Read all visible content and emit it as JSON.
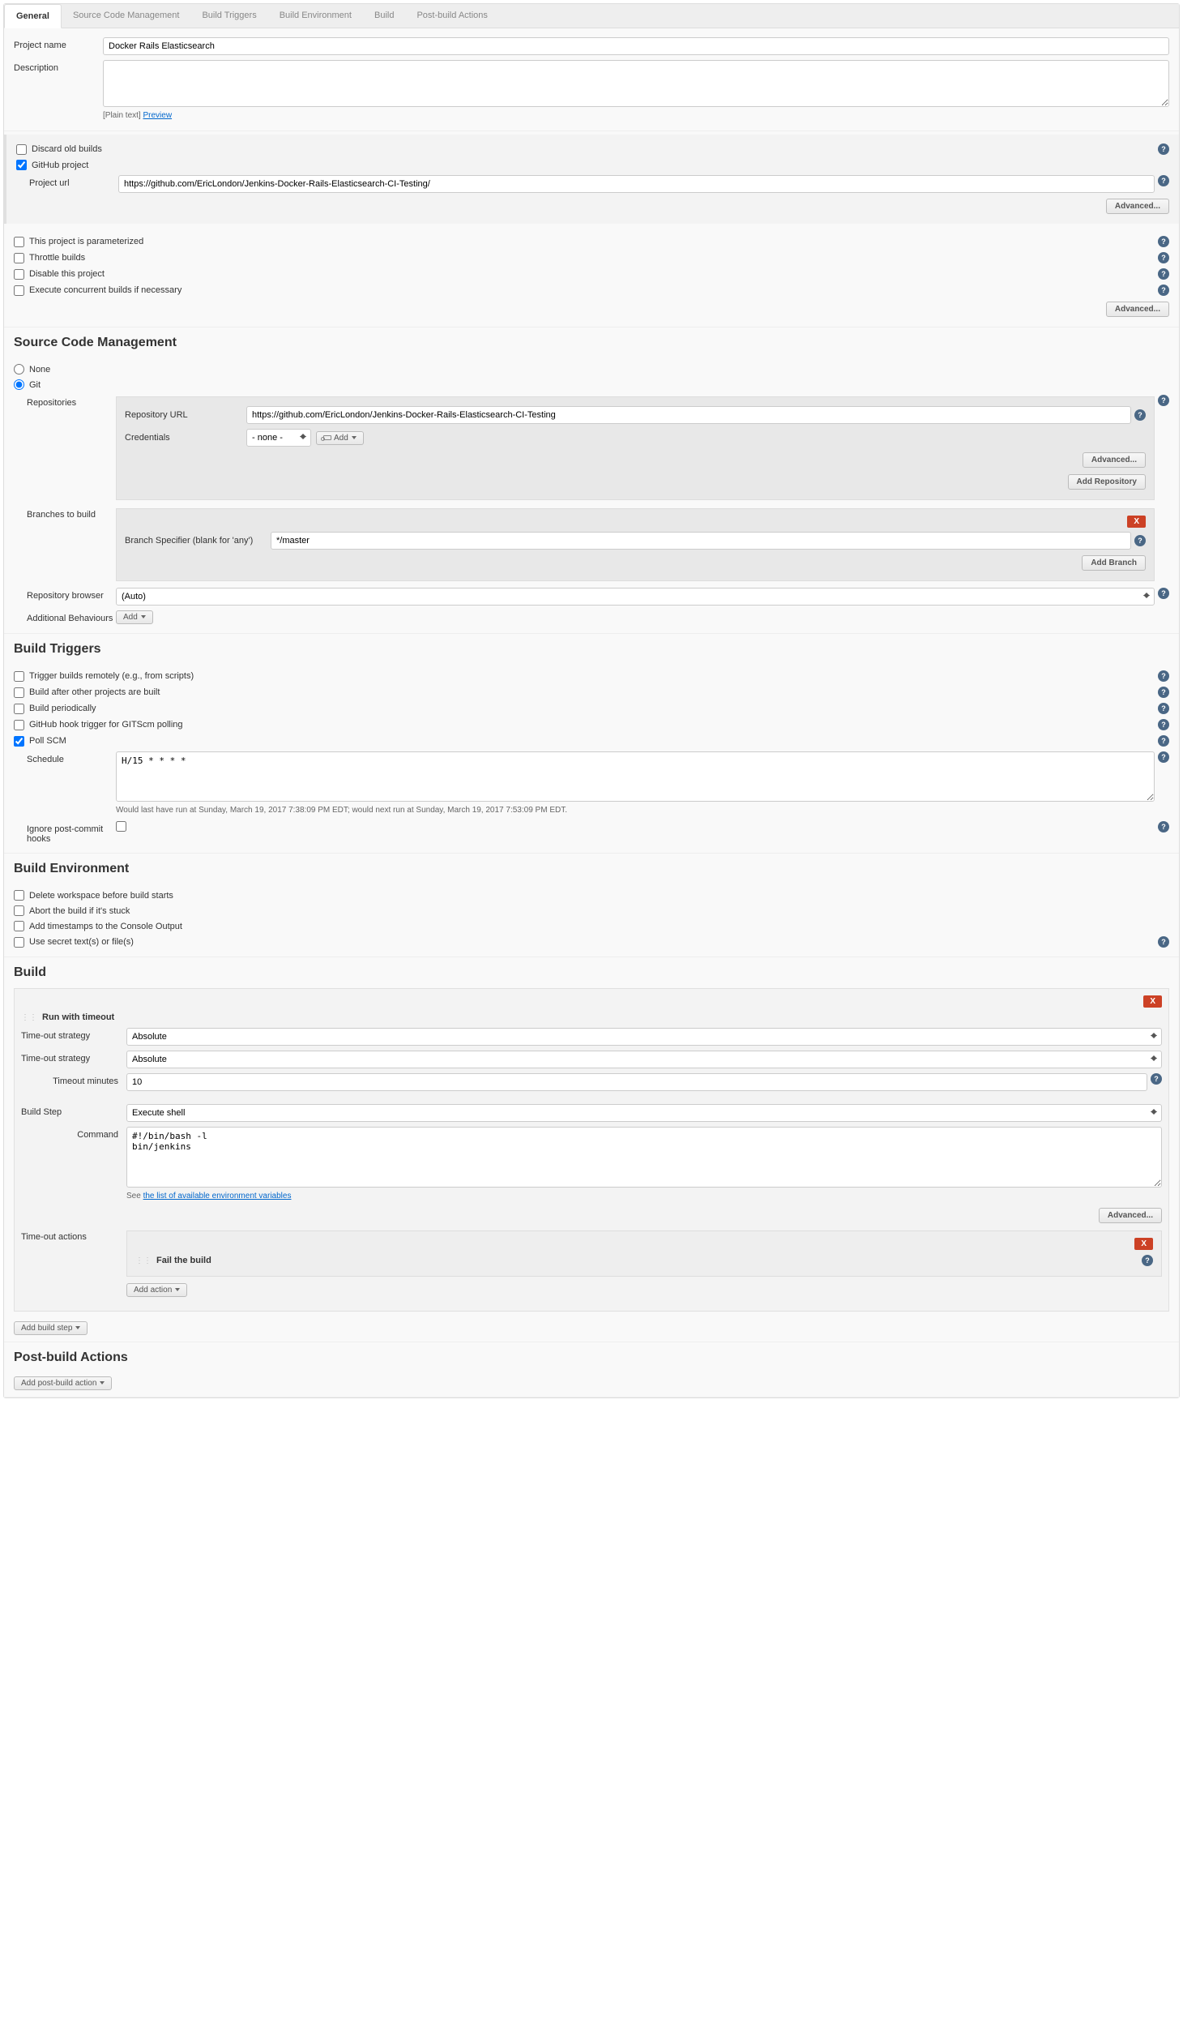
{
  "tabs": [
    "General",
    "Source Code Management",
    "Build Triggers",
    "Build Environment",
    "Build",
    "Post-build Actions"
  ],
  "general": {
    "projectName_lbl": "Project name",
    "projectName": "Docker Rails Elasticsearch",
    "description_lbl": "Description",
    "description": "",
    "plainText": "[Plain text]",
    "preview": "Preview",
    "discardOld": "Discard old builds",
    "github": "GitHub project",
    "projectUrl_lbl": "Project url",
    "projectUrl": "https://github.com/EricLondon/Jenkins-Docker-Rails-Elasticsearch-CI-Testing/",
    "advanced": "Advanced...",
    "parameterized": "This project is parameterized",
    "throttle": "Throttle builds",
    "disable": "Disable this project",
    "concurrent": "Execute concurrent builds if necessary"
  },
  "scm": {
    "heading": "Source Code Management",
    "none": "None",
    "git": "Git",
    "repositories_lbl": "Repositories",
    "repoUrl_lbl": "Repository URL",
    "repoUrl": "https://github.com/EricLondon/Jenkins-Docker-Rails-Elasticsearch-CI-Testing",
    "credentials_lbl": "Credentials",
    "credentials": "- none -",
    "addCred": "Add",
    "addRepo": "Add Repository",
    "branches_lbl": "Branches to build",
    "branchSpec_lbl": "Branch Specifier (blank for 'any')",
    "branchSpec": "*/master",
    "addBranch": "Add Branch",
    "repoBrowser_lbl": "Repository browser",
    "repoBrowser": "(Auto)",
    "additional_lbl": "Additional Behaviours",
    "addBehav": "Add",
    "advanced": "Advanced...",
    "x": "X"
  },
  "triggers": {
    "heading": "Build Triggers",
    "remote": "Trigger builds remotely (e.g., from scripts)",
    "after": "Build after other projects are built",
    "periodic": "Build periodically",
    "githubHook": "GitHub hook trigger for GITScm polling",
    "pollScm": "Poll SCM",
    "schedule_lbl": "Schedule",
    "schedule": "H/15 * * * *",
    "scheduleHint": "Would last have run at Sunday, March 19, 2017 7:38:09 PM EDT; would next run at Sunday, March 19, 2017 7:53:09 PM EDT.",
    "ignoreHooks": "Ignore post-commit hooks"
  },
  "env": {
    "heading": "Build Environment",
    "deleteWs": "Delete workspace before build starts",
    "abort": "Abort the build if it's stuck",
    "timestamps": "Add timestamps to the Console Output",
    "secret": "Use secret text(s) or file(s)"
  },
  "build": {
    "heading": "Build",
    "runTimeout": "Run with timeout",
    "x": "X",
    "strategy_lbl": "Time-out strategy",
    "strategy": "Absolute",
    "timeoutMin_lbl": "Timeout minutes",
    "timeoutMin": "10",
    "buildStep_lbl": "Build Step",
    "buildStep": "Execute shell",
    "command_lbl": "Command",
    "command": "#!/bin/bash -l\nbin/jenkins",
    "seeText": "See ",
    "envLink": "the list of available environment variables",
    "advanced": "Advanced...",
    "actions_lbl": "Time-out actions",
    "failBuild": "Fail the build",
    "addAction": "Add action",
    "addBuildStep": "Add build step"
  },
  "post": {
    "heading": "Post-build Actions",
    "addPost": "Add post-build action"
  }
}
